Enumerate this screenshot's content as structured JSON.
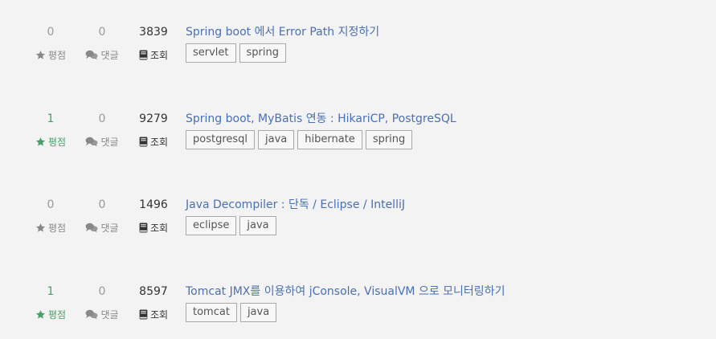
{
  "labels": {
    "rating": "평점",
    "comments": "댓글",
    "views": "조회"
  },
  "icons": {
    "rating": "star-icon",
    "comments": "comments-icon",
    "views": "book-icon"
  },
  "colors": {
    "link": "#4a6fb5",
    "positive": "#4a9e6a",
    "muted": "#999999"
  },
  "posts": [
    {
      "rating": "0",
      "comments": "0",
      "views": "3839",
      "title": "Spring boot 에서 Error Path 지정하기",
      "tags": [
        "servlet",
        "spring"
      ]
    },
    {
      "rating": "1",
      "comments": "0",
      "views": "9279",
      "title": "Spring boot, MyBatis 연동 : HikariCP, PostgreSQL",
      "tags": [
        "postgresql",
        "java",
        "hibernate",
        "spring"
      ]
    },
    {
      "rating": "0",
      "comments": "0",
      "views": "1496",
      "title": "Java Decompiler : 단독 / Eclipse / IntelliJ",
      "tags": [
        "eclipse",
        "java"
      ]
    },
    {
      "rating": "1",
      "comments": "0",
      "views": "8597",
      "title": "Tomcat JMX를 이용하여 jConsole, VisualVM 으로 모니터링하기",
      "tags": [
        "tomcat",
        "java"
      ]
    }
  ]
}
